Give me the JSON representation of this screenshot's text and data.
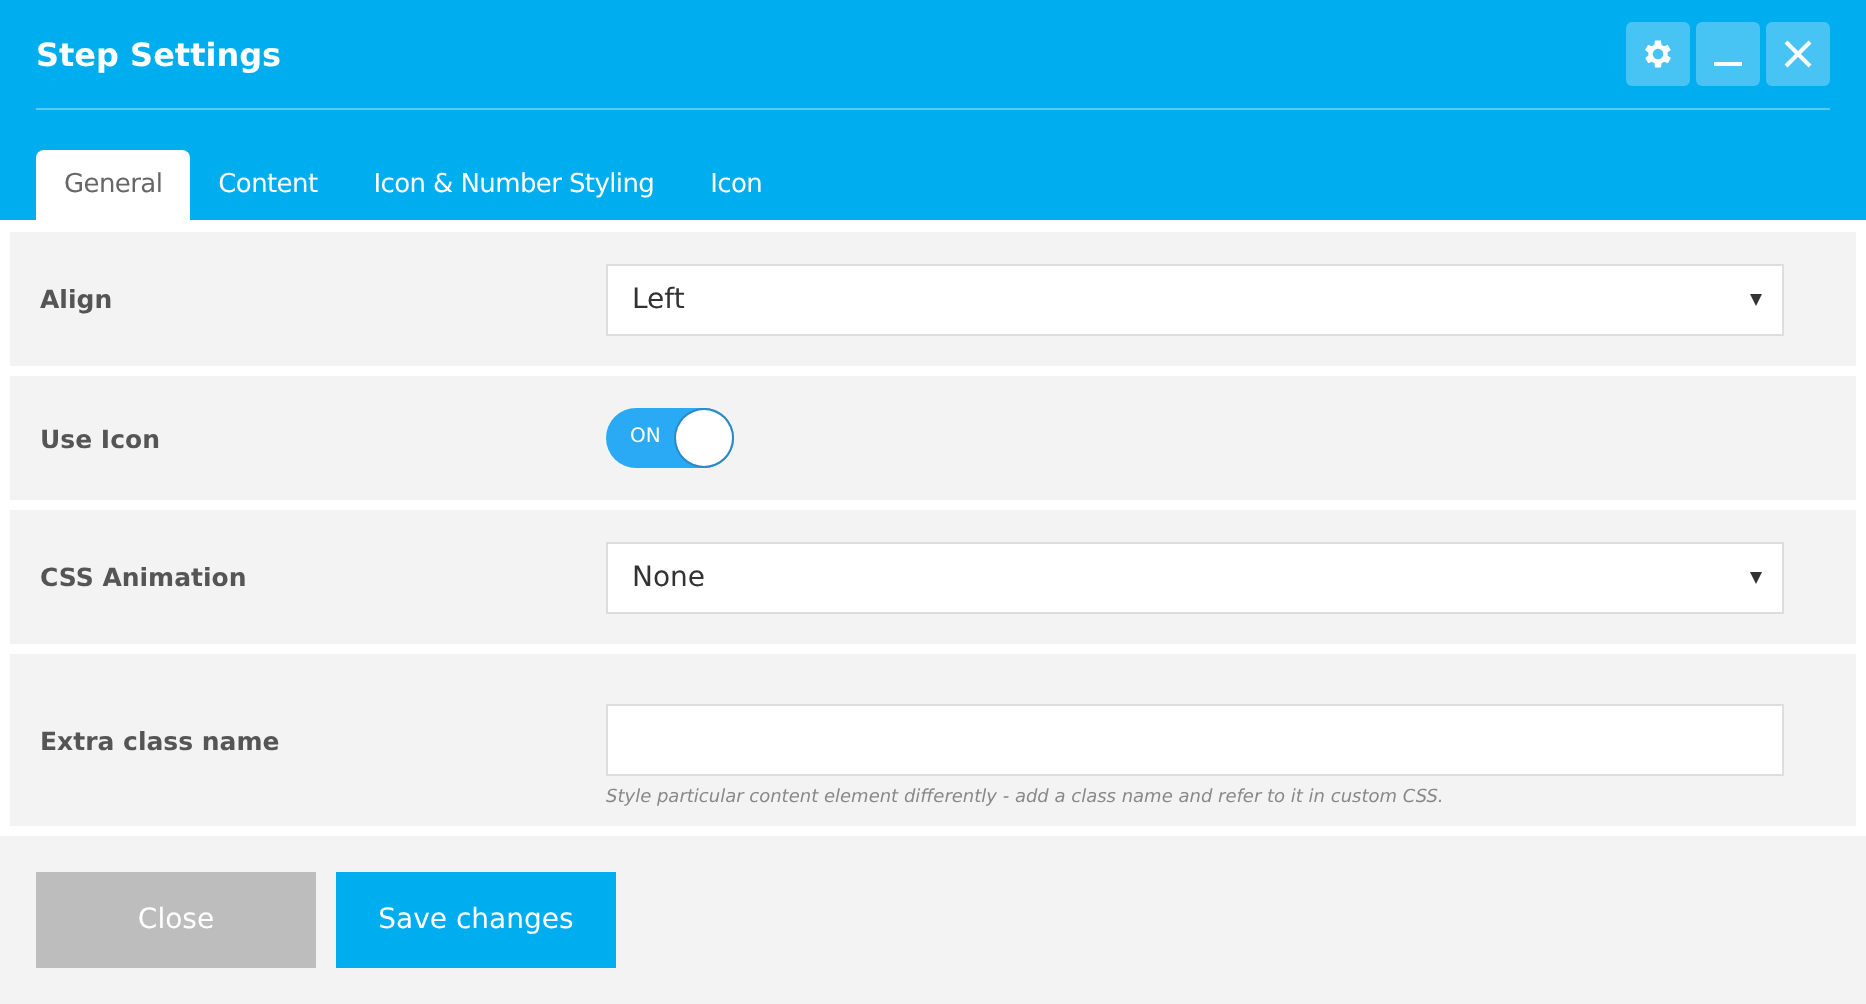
{
  "window": {
    "title": "Step Settings"
  },
  "tabs": [
    {
      "label": "General",
      "selected": true
    },
    {
      "label": "Content",
      "selected": false
    },
    {
      "label": "Icon & Number Styling",
      "selected": false
    },
    {
      "label": "Icon",
      "selected": false
    }
  ],
  "fields": [
    {
      "kind": "select",
      "label": "Align",
      "value": "Left"
    },
    {
      "kind": "toggle",
      "label": "Use Icon",
      "on": true,
      "toggle_text": "ON"
    },
    {
      "kind": "select",
      "label": "CSS Animation",
      "value": "None"
    },
    {
      "kind": "text",
      "label": "Extra class name",
      "help": "Style particular content element differently - add a class name and refer to it in custom CSS."
    }
  ],
  "buttons": [
    {
      "label": "Close",
      "kind": "secondary"
    },
    {
      "label": "Save changes",
      "kind": "primary"
    }
  ]
}
